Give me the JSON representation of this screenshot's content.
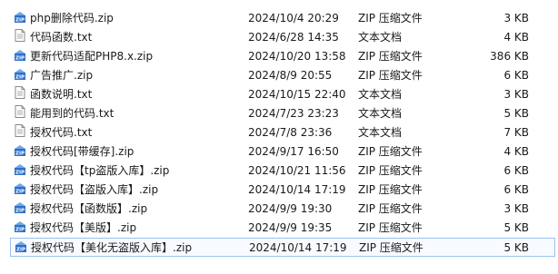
{
  "colors": {
    "zip_icon": "#2e6fc7",
    "selection_border": "#99c1ec"
  },
  "files": [
    {
      "name": "php删除代码.zip",
      "date": "2024/10/4 20:29",
      "type": "ZIP 压缩文件",
      "size": "3 KB",
      "icon": "zip-icon",
      "selected": false
    },
    {
      "name": "代码函数.txt",
      "date": "2024/6/28 14:35",
      "type": "文本文档",
      "size": "4 KB",
      "icon": "txt-icon",
      "selected": false
    },
    {
      "name": "更新代码适配PHP8.x.zip",
      "date": "2024/10/20 13:58",
      "type": "ZIP 压缩文件",
      "size": "386 KB",
      "icon": "zip-icon",
      "selected": false
    },
    {
      "name": "广告推广.zip",
      "date": "2024/8/9 20:55",
      "type": "ZIP 压缩文件",
      "size": "6 KB",
      "icon": "zip-icon",
      "selected": false
    },
    {
      "name": "函数说明.txt",
      "date": "2024/10/15 22:40",
      "type": "文本文档",
      "size": "3 KB",
      "icon": "txt-icon",
      "selected": false
    },
    {
      "name": "能用到的代码.txt",
      "date": "2024/7/23 23:23",
      "type": "文本文档",
      "size": "5 KB",
      "icon": "txt-icon",
      "selected": false
    },
    {
      "name": "授权代码.txt",
      "date": "2024/7/8 23:36",
      "type": "文本文档",
      "size": "7 KB",
      "icon": "txt-icon",
      "selected": false
    },
    {
      "name": "授权代码[带缓存].zip",
      "date": "2024/9/17 16:50",
      "type": "ZIP 压缩文件",
      "size": "4 KB",
      "icon": "zip-icon",
      "selected": false
    },
    {
      "name": "授权代码【tp盗版入库】.zip",
      "date": "2024/10/21 11:56",
      "type": "ZIP 压缩文件",
      "size": "6 KB",
      "icon": "zip-icon",
      "selected": false
    },
    {
      "name": "授权代码【盗版入库】.zip",
      "date": "2024/10/14 17:19",
      "type": "ZIP 压缩文件",
      "size": "6 KB",
      "icon": "zip-icon",
      "selected": false
    },
    {
      "name": "授权代码【函数版】.zip",
      "date": "2024/9/9 19:30",
      "type": "ZIP 压缩文件",
      "size": "3 KB",
      "icon": "zip-icon",
      "selected": false
    },
    {
      "name": "授权代码【美版】.zip",
      "date": "2024/9/9 19:35",
      "type": "ZIP 压缩文件",
      "size": "5 KB",
      "icon": "zip-icon",
      "selected": false
    },
    {
      "name": "授权代码【美化无盗版入库】.zip",
      "date": "2024/10/14 17:19",
      "type": "ZIP 压缩文件",
      "size": "5 KB",
      "icon": "zip-icon",
      "selected": true
    }
  ]
}
